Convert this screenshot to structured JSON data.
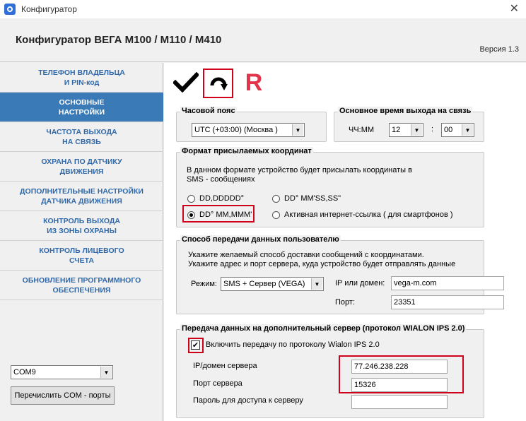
{
  "window": {
    "title": "Конфигуратор",
    "close_glyph": "✕"
  },
  "header": {
    "title": "Конфигуратор ВЕГА М100 / М110 / М410",
    "version": "Версия 1.3"
  },
  "sidebar": {
    "items": [
      {
        "label": "ТЕЛЕФОН ВЛАДЕЛЬЦА\nИ PIN-код"
      },
      {
        "label": "ОСНОВНЫЕ\nНАСТРОЙКИ",
        "active": true
      },
      {
        "label": "ЧАСТОТА ВЫХОДА\nНА СВЯЗЬ"
      },
      {
        "label": "ОХРАНА ПО ДАТЧИКУ\nДВИЖЕНИЯ"
      },
      {
        "label": "ДОПОЛНИТЕЛЬНЫЕ НАСТРОЙКИ\nДАТЧИКА ДВИЖЕНИЯ"
      },
      {
        "label": "КОНТРОЛЬ ВЫХОДА\nИЗ ЗОНЫ ОХРАНЫ"
      },
      {
        "label": "КОНТРОЛЬ ЛИЦЕВОГО\nСЧЕТА"
      },
      {
        "label": "ОБНОВЛЕНИЕ ПРОГРАММНОГО\nОБЕСПЕЧЕНИЯ"
      }
    ],
    "com_port": "COM9",
    "enumerate_button": "Перечислить COM - порты"
  },
  "toolbar": {
    "icons": [
      "checkmark-icon",
      "reload-icon",
      "r-letter-icon"
    ],
    "r_label": "R"
  },
  "timezone": {
    "legend": "Часовой пояс",
    "value": "UTC (+03:00) (Москва  )"
  },
  "main_time": {
    "legend": "Основное время выхода на связь",
    "label": "ЧЧ:ММ",
    "hours": "12",
    "separator": ":",
    "minutes": "00"
  },
  "coords": {
    "legend": "Формат присылаемых координат",
    "description": "В данном формате устройство будет присылать координаты в SMS - сообщениях",
    "options": [
      {
        "label": "DD,DDDDD°",
        "selected": false
      },
      {
        "label": "DD° MM'SS,SS\"",
        "selected": false
      },
      {
        "label": "DD° MM,MMM'",
        "selected": true
      },
      {
        "label": "Активная интернет-ссылка ( для смартфонов )",
        "selected": false
      }
    ]
  },
  "transfer": {
    "legend": "Способ передачи данных пользователю",
    "line1": "Укажите желаемый способ доставки сообщений с координатами.",
    "line2": "Укажите адрес и порт сервера, куда устройство будет отправлять данные",
    "mode_label": "Режим:",
    "mode_value": "SMS + Сервер (VEGA)",
    "ip_label": "IP или домен:",
    "ip_value": "vega-m.com",
    "port_label": "Порт:",
    "port_value": "23351"
  },
  "wialon": {
    "legend": "Передача данных на дополнительный сервер (протокол WIALON IPS 2.0)",
    "enable_label": "Включить передачу по протоколу Wialon IPS 2.0",
    "checked_glyph": "✔",
    "server_label": "IP/домен сервера",
    "server_value": "77.246.238.228",
    "port_label": "Порт сервера",
    "port_value": "15326",
    "password_label": "Пароль для доступа к серверу",
    "password_value": ""
  },
  "colors": {
    "accent": "#3a7bb7",
    "nav_text": "#3169a8",
    "highlight": "#d0021b",
    "r_letter": "#e0354a"
  }
}
